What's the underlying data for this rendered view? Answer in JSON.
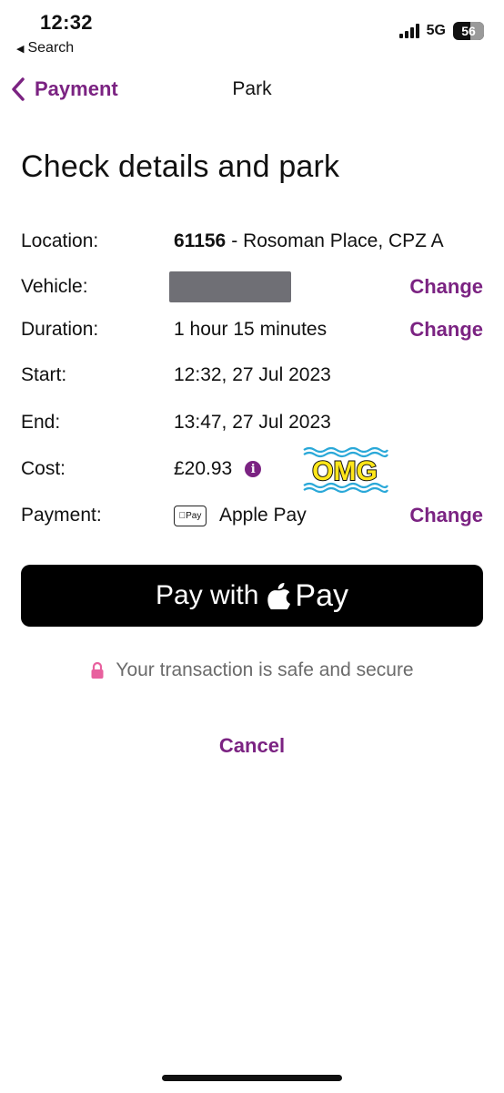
{
  "status_bar": {
    "time": "12:32",
    "back_app": "Search",
    "network": "5G",
    "battery": "56",
    "battery_level": 0.56
  },
  "nav": {
    "back_label": "Payment",
    "title": "Park"
  },
  "page": {
    "title": "Check details and park"
  },
  "details": {
    "location": {
      "label": "Location:",
      "code": "61156",
      "name": "- Rosoman Place, CPZ A"
    },
    "vehicle": {
      "label": "Vehicle:",
      "change": "Change"
    },
    "duration": {
      "label": "Duration:",
      "value": "1 hour 15 minutes",
      "change": "Change"
    },
    "start": {
      "label": "Start:",
      "value": "12:32, 27 Jul 2023"
    },
    "end": {
      "label": "End:",
      "value": "13:47, 27 Jul 2023"
    },
    "cost": {
      "label": "Cost:",
      "value": "£20.93",
      "info": "i",
      "sticker": "OMG"
    },
    "payment": {
      "label": "Payment:",
      "method_mark": "Pay",
      "method": "Apple Pay",
      "change": "Change"
    }
  },
  "pay_button": {
    "prefix": "Pay with",
    "suffix": "Pay"
  },
  "secure_note": "Your transaction is safe and secure",
  "cancel_label": "Cancel",
  "colors": {
    "accent": "#7b2382",
    "lock": "#e8609e",
    "sticker_fill": "#ffe61a",
    "sticker_wave": "#2aa8d8"
  }
}
